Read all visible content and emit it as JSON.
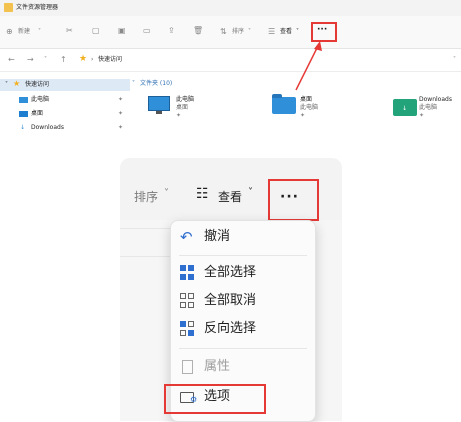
{
  "window": {
    "title": "文件资源管理器"
  },
  "toolbar": {
    "new_label": "新建",
    "sort_label": "排序",
    "view_label": "查看",
    "more_label": "···"
  },
  "address": {
    "path": "快速访问",
    "separator": "›"
  },
  "nav_pane": {
    "items": [
      {
        "label": "快速访问",
        "icon": "star-icon"
      },
      {
        "label": "此电脑",
        "icon": "computer-icon"
      },
      {
        "label": "桌面",
        "icon": "desktop-icon"
      },
      {
        "label": "Downloads",
        "icon": "download-icon"
      }
    ]
  },
  "content": {
    "group_header": "文件夹 (10)",
    "folders": [
      {
        "name": "此电脑",
        "sub": "桌面",
        "icon": "monitor-icon"
      },
      {
        "name": "桌面",
        "sub": "此电脑",
        "icon": "folder-icon"
      },
      {
        "name": "Downloads",
        "sub": "此电脑",
        "icon": "downloads-folder-icon"
      }
    ]
  },
  "zoom": {
    "sort_label": "排序",
    "view_label": "查看",
    "more_label": "···",
    "menu_items": [
      {
        "label": "撤消",
        "icon": "undo-icon",
        "enabled": true
      },
      {
        "label": "全部选择",
        "icon": "select-all-icon",
        "enabled": true
      },
      {
        "label": "全部取消",
        "icon": "select-none-icon",
        "enabled": true
      },
      {
        "label": "反向选择",
        "icon": "invert-selection-icon",
        "enabled": true
      },
      {
        "label": "属性",
        "icon": "properties-icon",
        "enabled": false
      },
      {
        "label": "选项",
        "icon": "options-icon",
        "enabled": true
      }
    ]
  },
  "colors": {
    "highlight": "#e53935",
    "accent": "#0078d4",
    "folder": "#2f8fd8"
  }
}
